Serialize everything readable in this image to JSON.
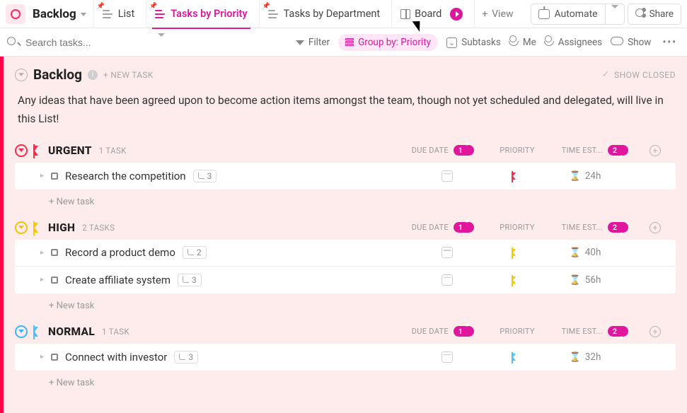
{
  "header": {
    "title": "Backlog",
    "tabs": [
      {
        "label": "List",
        "pinned": true
      },
      {
        "label": "Tasks by Priority",
        "pinned": true
      },
      {
        "label": "Tasks by Department",
        "pinned": true
      },
      {
        "label": "Board",
        "pinned": false
      }
    ],
    "add_view": "View",
    "automate": "Automate",
    "share": "Share"
  },
  "filterbar": {
    "search_placeholder": "Search tasks...",
    "filter": "Filter",
    "group_by": "Group by: Priority",
    "subtasks": "Subtasks",
    "me": "Me",
    "assignees": "Assignees",
    "show": "Show"
  },
  "list": {
    "title": "Backlog",
    "new_task_label": "+ NEW TASK",
    "show_closed": "SHOW CLOSED",
    "description": "Any ideas that have been agreed upon to become action items amongst the team, though not yet scheduled and delegated, will live in this List!"
  },
  "columns": {
    "due": "DUE DATE",
    "priority": "PRIORITY",
    "estimate": "TIME EST...",
    "due_badge": "1",
    "est_badge": "2"
  },
  "groups": [
    {
      "name": "URGENT",
      "count_label": "1 TASK",
      "ring": "ring-red",
      "flag": "flag-red",
      "tasks": [
        {
          "name": "Research the competition",
          "subs": "3",
          "flag": "flag-red",
          "estimate": "24h"
        }
      ]
    },
    {
      "name": "HIGH",
      "count_label": "2 TASKS",
      "ring": "ring-yellow",
      "flag": "flag-yellow",
      "tasks": [
        {
          "name": "Record a product demo",
          "subs": "2",
          "flag": "flag-yellow",
          "estimate": "40h"
        },
        {
          "name": "Create affiliate system",
          "subs": "3",
          "flag": "flag-yellow",
          "estimate": "56h"
        }
      ]
    },
    {
      "name": "NORMAL",
      "count_label": "1 TASK",
      "ring": "ring-blue",
      "flag": "flag-blue",
      "tasks": [
        {
          "name": "Connect with investor",
          "subs": "3",
          "flag": "flag-blue",
          "estimate": "32h"
        }
      ]
    }
  ],
  "new_task_inline": "+ New task"
}
